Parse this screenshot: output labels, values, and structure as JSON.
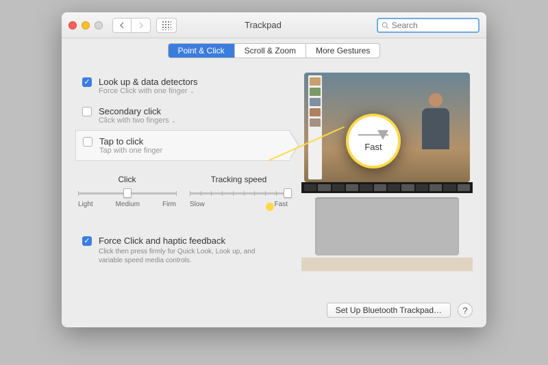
{
  "window": {
    "title": "Trackpad"
  },
  "search": {
    "placeholder": "Search"
  },
  "tabs": {
    "point_click": "Point & Click",
    "scroll_zoom": "Scroll & Zoom",
    "more_gestures": "More Gestures"
  },
  "options": {
    "lookup": {
      "title": "Look up & data detectors",
      "sub": "Force Click with one finger",
      "checked": true
    },
    "secondary": {
      "title": "Secondary click",
      "sub": "Click with two fingers",
      "checked": false
    },
    "tap": {
      "title": "Tap to click",
      "sub": "Tap with one finger",
      "checked": false
    }
  },
  "sliders": {
    "click": {
      "label": "Click",
      "marks": {
        "low": "Light",
        "mid": "Medium",
        "high": "Firm"
      },
      "value_pct": 50
    },
    "tracking": {
      "label": "Tracking speed",
      "marks": {
        "low": "Slow",
        "high": "Fast"
      },
      "value_pct": 100
    }
  },
  "force": {
    "title": "Force Click and haptic feedback",
    "desc": "Click then press firmly for Quick Look, Look up, and variable speed media controls.",
    "checked": true
  },
  "callout": {
    "label": "Fast"
  },
  "footer": {
    "bluetooth": "Set Up Bluetooth Trackpad…",
    "help": "?"
  }
}
